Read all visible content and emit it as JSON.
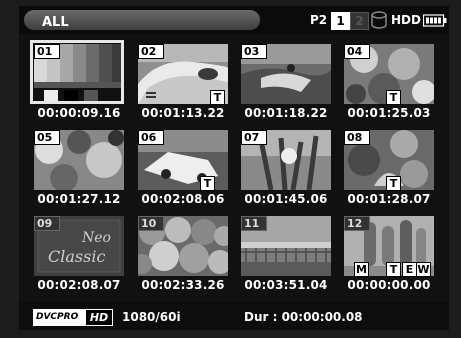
{
  "header": {
    "mode_label": "ALL",
    "p2_label": "P2",
    "slot_1": "1",
    "slot_2": "2",
    "hdd_label": "HDD"
  },
  "clips": [
    {
      "num": "01",
      "timecode": "00:00:09.16",
      "text_memo": false,
      "selected": true
    },
    {
      "num": "02",
      "timecode": "00:01:13.22",
      "text_memo": true,
      "selected": false
    },
    {
      "num": "03",
      "timecode": "00:01:18.22",
      "text_memo": false,
      "selected": false
    },
    {
      "num": "04",
      "timecode": "00:01:25.03",
      "text_memo": true,
      "selected": false
    },
    {
      "num": "05",
      "timecode": "00:01:27.12",
      "text_memo": false,
      "selected": false
    },
    {
      "num": "06",
      "timecode": "00:02:08.06",
      "text_memo": true,
      "selected": false
    },
    {
      "num": "07",
      "timecode": "00:01:45.06",
      "text_memo": false,
      "selected": false
    },
    {
      "num": "08",
      "timecode": "00:01:28.07",
      "text_memo": true,
      "selected": false
    },
    {
      "num": "09",
      "timecode": "00:02:08.07",
      "text_memo": false,
      "selected": false
    },
    {
      "num": "10",
      "timecode": "00:02:33.26",
      "text_memo": false,
      "selected": false
    },
    {
      "num": "11",
      "timecode": "00:03:51.04",
      "text_memo": false,
      "selected": false
    },
    {
      "num": "12",
      "timecode": "00:00:00.00",
      "text_memo": true,
      "selected": false
    }
  ],
  "clip9_text": "Neo\nClassic",
  "clip12_badges": [
    "M",
    "T",
    "E",
    "W"
  ],
  "footer": {
    "format_text": "DVCPRO",
    "format_hd": "HD",
    "resolution": "1080/60i",
    "duration": "Dur : 00:00:00.08"
  }
}
